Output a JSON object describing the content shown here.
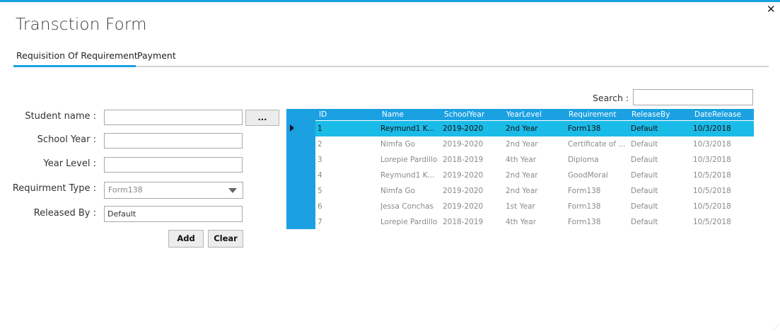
{
  "window": {
    "title": "Transction Form",
    "close_label": "✕"
  },
  "tabs": [
    {
      "label": "Requisition Of Requirement",
      "active": true
    },
    {
      "label": "Payment",
      "active": false
    }
  ],
  "form": {
    "student_name_label": "Student name :",
    "student_name_value": "",
    "browse_label": "...",
    "school_year_label": "School Year :",
    "school_year_value": "",
    "year_level_label": "Year Level :",
    "year_level_value": "",
    "requirement_type_label": "Requirment Type :",
    "requirement_type_value": "Form138",
    "released_by_label": "Released By :",
    "released_by_value": "Default",
    "add_label": "Add",
    "clear_label": "Clear"
  },
  "search": {
    "label": "Search :",
    "value": ""
  },
  "table": {
    "columns": [
      "ID",
      "Name",
      "SchoolYear",
      "YearLevel",
      "Requirement",
      "ReleaseBy",
      "DateRelease"
    ],
    "rows": [
      [
        "1",
        "Reymund1 Ku...",
        "2019-2020",
        "2nd Year",
        "Form138",
        "Default",
        "10/3/2018"
      ],
      [
        "2",
        "Nimfa Go",
        "2019-2020",
        "2nd Year",
        "Certificate of ...",
        "Default",
        "10/3/2018"
      ],
      [
        "3",
        "Lorepie Pardillo",
        "2018-2019",
        "4th Year",
        "Diploma",
        "Default",
        "10/3/2018"
      ],
      [
        "4",
        "Reymund1 Ku...",
        "2019-2020",
        "2nd Year",
        "GoodMoral",
        "Default",
        "10/5/2018"
      ],
      [
        "5",
        "Nimfa Go",
        "2019-2020",
        "2nd Year",
        "Form138",
        "Default",
        "10/5/2018"
      ],
      [
        "6",
        "Jessa Conchas",
        "2019-2020",
        "1st Year",
        "Form138",
        "Default",
        "10/5/2018"
      ],
      [
        "7",
        "Lorepie Pardillo",
        "2018-2019",
        "4th Year",
        "Form138",
        "Default",
        "10/5/2018"
      ]
    ],
    "selected_row": 0
  },
  "colors": {
    "accent": "#1ba1e2",
    "selected_row": "#1bbbe8"
  }
}
